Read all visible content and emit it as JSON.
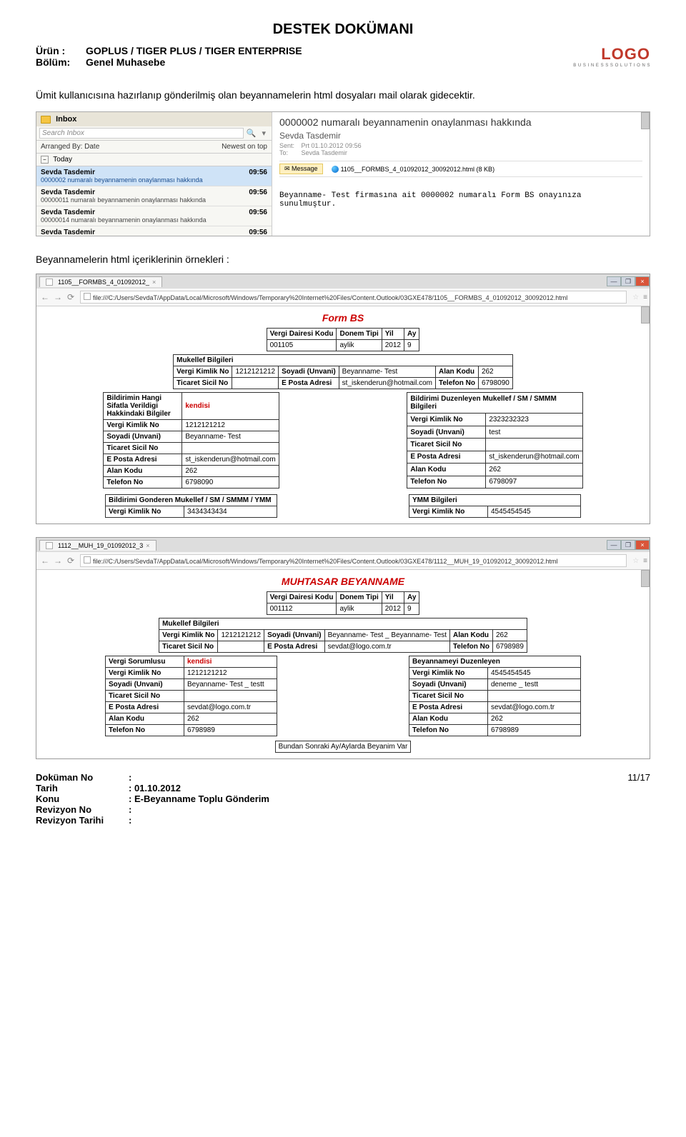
{
  "doc": {
    "title": "DESTEK DOKÜMANI",
    "urun_lbl": "Ürün  :",
    "urun_val": "GOPLUS / TIGER PLUS / TIGER ENTERPRISE",
    "bolum_lbl": "Bölüm:",
    "bolum_val": "Genel Muhasebe",
    "logo_text": "LOGO",
    "logo_sub": "B U S I N E S S   S O L U T I O N S"
  },
  "p1": "Ümit kullanıcısına hazırlanıp gönderilmiş olan beyannamelerin html dosyaları mail olarak gidecektir.",
  "outlook": {
    "inbox": "Inbox",
    "search": "Search Inbox",
    "arr_by": "Arranged By: Date",
    "newest": "Newest on top",
    "today": "Today",
    "msgs": [
      {
        "from": "Sevda Tasdemir",
        "time": "09:56",
        "subj": "0000002 numaralı beyannamenin onaylanması hakkında",
        "sel": true
      },
      {
        "from": "Sevda Tasdemir",
        "time": "09:56",
        "subj": "00000011 numaralı beyannamenin onaylanması hakkında",
        "sel": false
      },
      {
        "from": "Sevda Tasdemir",
        "time": "09:56",
        "subj": "00000014 numaralı beyannamenin onaylanması hakkında",
        "sel": false
      },
      {
        "from": "Sevda Tasdemir",
        "time": "09:56",
        "subj": "",
        "sel": false
      }
    ],
    "preview": {
      "subject": "0000002 numaralı beyannamenin onaylanması hakkında",
      "from": "Sevda Tasdemir",
      "sent_lbl": "Sent:",
      "sent_val": "Prt 01.10.2012 09:56",
      "to_lbl": "To:",
      "to_val": "Sevda Tasdemir",
      "msg_tab": "Message",
      "attachment": "1105__FORMBS_4_01092012_30092012.html (8 KB)",
      "body": "Beyanname- Test firmasına ait 0000002 numaralı Form BS onayınıza sunulmuştur."
    }
  },
  "p2": "Beyannamelerin html içeriklerinin örnekleri :",
  "browser1": {
    "tab": "1105__FORMBS_4_01092012_",
    "url": "file:///C:/Users/SevdaT/AppData/Local/Microsoft/Windows/Temporary%20Internet%20Files/Content.Outlook/03GXE478/1105__FORMBS_4_01092012_30092012.html",
    "title": "Form BS",
    "hdr": {
      "c1": "Vergi Dairesi Kodu",
      "c2": "Donem Tipi",
      "c3": "Yil",
      "c4": "Ay",
      "v1": "001105",
      "v2": "aylik",
      "v3": "2012",
      "v4": "9"
    },
    "muk": {
      "title": "Mukellef Bilgileri",
      "r1": {
        "l1": "Vergi Kimlik No",
        "v1": "1212121212",
        "l2": "Soyadi (Unvani)",
        "v2": "Beyanname- Test",
        "l3": "Alan Kodu",
        "v3": "262"
      },
      "r2": {
        "l1": "Ticaret Sicil No",
        "v1": "",
        "l2": "E Posta Adresi",
        "v2": "st_iskenderun@hotmail.com",
        "l3": "Telefon No",
        "v3": "6798090"
      }
    },
    "left": {
      "title": "Bildirimin Hangi Sifatla Verildigi Hakkindaki Bilgiler",
      "title_val": "kendisi",
      "rows": [
        {
          "l": "Vergi Kimlik No",
          "v": "1212121212"
        },
        {
          "l": "Soyadi (Unvani)",
          "v": "Beyanname- Test"
        },
        {
          "l": "Ticaret Sicil No",
          "v": ""
        },
        {
          "l": "E Posta Adresi",
          "v": "st_iskenderun@hotmail.com"
        },
        {
          "l": "Alan Kodu",
          "v": "262"
        },
        {
          "l": "Telefon No",
          "v": "6798090"
        }
      ]
    },
    "right": {
      "title": "Bildirimi Duzenleyen Mukellef / SM / SMMM Bilgileri",
      "rows": [
        {
          "l": "Vergi Kimlik No",
          "v": "2323232323"
        },
        {
          "l": "Soyadi (Unvani)",
          "v": "test"
        },
        {
          "l": "Ticaret Sicil No",
          "v": ""
        },
        {
          "l": "E Posta Adresi",
          "v": "st_iskenderun@hotmail.com"
        },
        {
          "l": "Alan Kodu",
          "v": "262"
        },
        {
          "l": "Telefon No",
          "v": "6798097"
        }
      ]
    },
    "bottom_left": {
      "title": "Bildirimi Gonderen Mukellef / SM / SMMM / YMM",
      "l": "Vergi Kimlik No",
      "v": "3434343434"
    },
    "bottom_right": {
      "title": "YMM Bilgileri",
      "l": "Vergi Kimlik No",
      "v": "4545454545"
    }
  },
  "browser2": {
    "tab": "1112__MUH_19_01092012_3",
    "url": "file:///C:/Users/SevdaT/AppData/Local/Microsoft/Windows/Temporary%20Internet%20Files/Content.Outlook/03GXE478/1112__MUH_19_01092012_30092012.html",
    "title": "MUHTASAR BEYANNAME",
    "hdr": {
      "c1": "Vergi Dairesi Kodu",
      "c2": "Donem Tipi",
      "c3": "Yil",
      "c4": "Ay",
      "v1": "001112",
      "v2": "aylik",
      "v3": "2012",
      "v4": "9"
    },
    "muk": {
      "title": "Mukellef Bilgileri",
      "r1": {
        "l1": "Vergi Kimlik No",
        "v1": "1212121212",
        "l2": "Soyadi (Unvani)",
        "v2": "Beyanname- Test _ Beyanname- Test",
        "l3": "Alan Kodu",
        "v3": "262"
      },
      "r2": {
        "l1": "Ticaret Sicil No",
        "v1": "",
        "l2": "E Posta Adresi",
        "v2": "sevdat@logo.com.tr",
        "l3": "Telefon No",
        "v3": "6798989"
      }
    },
    "left": {
      "title": "Vergi Sorumlusu",
      "title_val": "kendisi",
      "rows": [
        {
          "l": "Vergi Kimlik No",
          "v": "1212121212"
        },
        {
          "l": "Soyadi (Unvani)",
          "v": "Beyanname- Test _ testt"
        },
        {
          "l": "Ticaret Sicil No",
          "v": ""
        },
        {
          "l": "E Posta Adresi",
          "v": "sevdat@logo.com.tr"
        },
        {
          "l": "Alan Kodu",
          "v": "262"
        },
        {
          "l": "Telefon No",
          "v": "6798989"
        }
      ]
    },
    "right": {
      "title": "Beyannameyi Duzenleyen",
      "rows": [
        {
          "l": "Vergi Kimlik No",
          "v": "4545454545"
        },
        {
          "l": "Soyadi (Unvani)",
          "v": "deneme _ testt"
        },
        {
          "l": "Ticaret Sicil No",
          "v": ""
        },
        {
          "l": "E Posta Adresi",
          "v": "sevdat@logo.com.tr"
        },
        {
          "l": "Alan Kodu",
          "v": "262"
        },
        {
          "l": "Telefon No",
          "v": "6798989"
        }
      ]
    },
    "bottom": "Bundan Sonraki Ay/Aylarda Beyanim Var"
  },
  "footer": {
    "dokno_l": "Doküman No",
    "dokno_v": ":",
    "tarih_l": "Tarih",
    "tarih_v": ": 01.10.2012",
    "konu_l": "Konu",
    "konu_v": ": E-Beyanname Toplu Gönderim",
    "revno_l": "Revizyon No",
    "revno_v": ":",
    "revt_l": "Revizyon Tarihi",
    "revt_v": ":",
    "page": "11/17"
  }
}
